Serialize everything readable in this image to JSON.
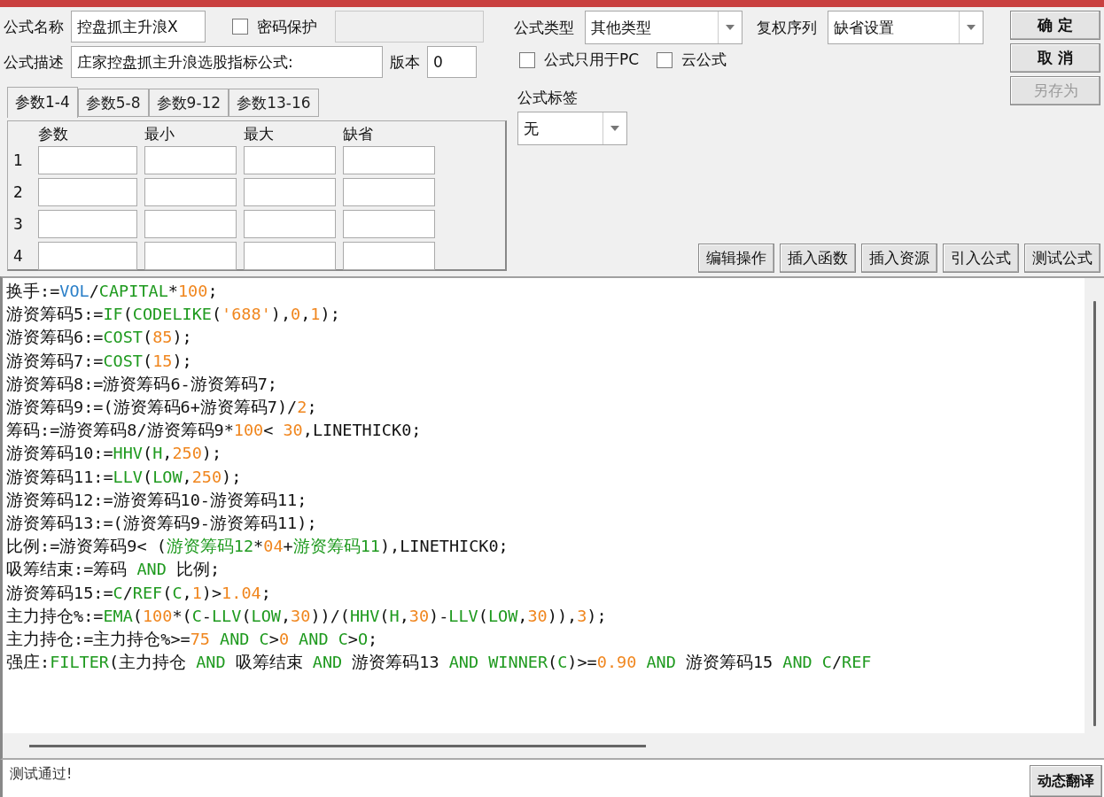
{
  "form": {
    "name_label": "公式名称",
    "name_value": "控盘抓主升浪X",
    "password": {
      "label": "密码保护",
      "checked": false
    },
    "description_label": "公式描述",
    "description_value": "庄家控盘抓主升浪选股指标公式:",
    "version_label": "版本",
    "version_value": "0"
  },
  "param_tabs": [
    {
      "label": "参数1-4",
      "selected": true
    },
    {
      "label": "参数5-8",
      "selected": false
    },
    {
      "label": "参数9-12",
      "selected": false
    },
    {
      "label": "参数13-16",
      "selected": false
    }
  ],
  "param_columns": [
    "参数",
    "最小",
    "最大",
    "缺省"
  ],
  "param_rows": [
    "1",
    "2",
    "3",
    "4"
  ],
  "formula_type": {
    "label": "公式类型",
    "value": "其他类型"
  },
  "rights_order": {
    "label": "复权序列",
    "value": "缺省设置"
  },
  "options": [
    {
      "label": "公式只用于PC",
      "checked": false
    },
    {
      "label": "云公式",
      "checked": false
    }
  ],
  "tag": {
    "label": "公式标签",
    "value": "无"
  },
  "dialog_buttons": [
    {
      "label": "确 定",
      "disabled": false
    },
    {
      "label": "取 消",
      "disabled": false
    },
    {
      "label": "另存为",
      "disabled": true
    }
  ],
  "tool_buttons": [
    "编辑操作",
    "插入函数",
    "插入资源",
    "引入公式",
    "测试公式"
  ],
  "code_lines": [
    [
      {
        "kind": "plain",
        "text": "换手:="
      },
      {
        "kind": "var",
        "text": "VOL"
      },
      {
        "kind": "plain",
        "text": "/"
      },
      {
        "kind": "func",
        "text": "CAPITAL"
      },
      {
        "kind": "plain",
        "text": "*"
      },
      {
        "kind": "num",
        "text": "100"
      },
      {
        "kind": "plain",
        "text": ";"
      }
    ],
    [
      {
        "kind": "plain",
        "text": "游资筹码5:="
      },
      {
        "kind": "func",
        "text": "IF"
      },
      {
        "kind": "plain",
        "text": "("
      },
      {
        "kind": "func",
        "text": "CODELIKE"
      },
      {
        "kind": "plain",
        "text": "("
      },
      {
        "kind": "num",
        "text": "'688'"
      },
      {
        "kind": "plain",
        "text": "),"
      },
      {
        "kind": "num",
        "text": "0"
      },
      {
        "kind": "plain",
        "text": ","
      },
      {
        "kind": "num",
        "text": "1"
      },
      {
        "kind": "plain",
        "text": ");"
      }
    ],
    [
      {
        "kind": "plain",
        "text": "游资筹码6:="
      },
      {
        "kind": "func",
        "text": "COST"
      },
      {
        "kind": "plain",
        "text": "("
      },
      {
        "kind": "num",
        "text": "85"
      },
      {
        "kind": "plain",
        "text": ");"
      }
    ],
    [
      {
        "kind": "plain",
        "text": "游资筹码7:="
      },
      {
        "kind": "func",
        "text": "COST"
      },
      {
        "kind": "plain",
        "text": "("
      },
      {
        "kind": "num",
        "text": "15"
      },
      {
        "kind": "plain",
        "text": ");"
      }
    ],
    [
      {
        "kind": "plain",
        "text": "游资筹码8:=游资筹码6-游资筹码7;"
      }
    ],
    [
      {
        "kind": "plain",
        "text": "游资筹码9:=(游资筹码6+游资筹码7)/"
      },
      {
        "kind": "num",
        "text": "2"
      },
      {
        "kind": "plain",
        "text": ";"
      }
    ],
    [
      {
        "kind": "plain",
        "text": "筹码:=游资筹码8/游资筹码9*"
      },
      {
        "kind": "num",
        "text": "100"
      },
      {
        "kind": "plain",
        "text": "<"
      },
      {
        "kind": "num",
        "text": "30",
        "space": true
      },
      {
        "kind": "plain",
        "text": ",LINETHICK0;"
      }
    ],
    [
      {
        "kind": "plain",
        "text": "游资筹码10:="
      },
      {
        "kind": "func",
        "text": "HHV"
      },
      {
        "kind": "plain",
        "text": "("
      },
      {
        "kind": "func",
        "text": "H"
      },
      {
        "kind": "plain",
        "text": ","
      },
      {
        "kind": "num",
        "text": "250"
      },
      {
        "kind": "plain",
        "text": ");"
      }
    ],
    [
      {
        "kind": "plain",
        "text": "游资筹码11:="
      },
      {
        "kind": "func",
        "text": "LLV"
      },
      {
        "kind": "plain",
        "text": "("
      },
      {
        "kind": "func",
        "text": "LOW"
      },
      {
        "kind": "plain",
        "text": ","
      },
      {
        "kind": "num",
        "text": "250"
      },
      {
        "kind": "plain",
        "text": ");"
      }
    ],
    [
      {
        "kind": "plain",
        "text": "游资筹码12:=游资筹码10-游资筹码11;"
      }
    ],
    [
      {
        "kind": "plain",
        "text": "游资筹码13:=(游资筹码9-游资筹码11);"
      }
    ],
    [
      {
        "kind": "plain",
        "text": "比例:=游资筹码9< ("
      },
      {
        "kind": "func",
        "text": "游资筹码12"
      },
      {
        "kind": "plain",
        "text": "*"
      },
      {
        "kind": "num",
        "text": "04"
      },
      {
        "kind": "plain",
        "text": "+"
      },
      {
        "kind": "func",
        "text": "游资筹码11"
      },
      {
        "kind": "plain",
        "text": "),LINETHICK0;"
      }
    ],
    [
      {
        "kind": "plain",
        "text": "吸筹结束:=筹码"
      },
      {
        "kind": "func",
        "text": "AND",
        "space": true
      },
      {
        "kind": "plain",
        "text": "比例;",
        "space": true
      }
    ],
    [
      {
        "kind": "plain",
        "text": "游资筹码15:="
      },
      {
        "kind": "func",
        "text": "C"
      },
      {
        "kind": "plain",
        "text": "/"
      },
      {
        "kind": "func",
        "text": "REF"
      },
      {
        "kind": "plain",
        "text": "("
      },
      {
        "kind": "func",
        "text": "C"
      },
      {
        "kind": "plain",
        "text": ","
      },
      {
        "kind": "num",
        "text": "1"
      },
      {
        "kind": "plain",
        "text": ")>"
      },
      {
        "kind": "num",
        "text": "1.04"
      },
      {
        "kind": "plain",
        "text": ";"
      }
    ],
    [
      {
        "kind": "plain",
        "text": "主力持仓%:="
      },
      {
        "kind": "func",
        "text": "EMA"
      },
      {
        "kind": "plain",
        "text": "("
      },
      {
        "kind": "num",
        "text": "100"
      },
      {
        "kind": "plain",
        "text": "*("
      },
      {
        "kind": "func",
        "text": "C"
      },
      {
        "kind": "plain",
        "text": "-"
      },
      {
        "kind": "func",
        "text": "LLV"
      },
      {
        "kind": "plain",
        "text": "("
      },
      {
        "kind": "func",
        "text": "LOW"
      },
      {
        "kind": "plain",
        "text": ","
      },
      {
        "kind": "num",
        "text": "30"
      },
      {
        "kind": "plain",
        "text": "))/("
      },
      {
        "kind": "func",
        "text": "HHV"
      },
      {
        "kind": "plain",
        "text": "("
      },
      {
        "kind": "func",
        "text": "H"
      },
      {
        "kind": "plain",
        "text": ","
      },
      {
        "kind": "num",
        "text": "30"
      },
      {
        "kind": "plain",
        "text": ")-"
      },
      {
        "kind": "func",
        "text": "LLV"
      },
      {
        "kind": "plain",
        "text": "("
      },
      {
        "kind": "func",
        "text": "LOW"
      },
      {
        "kind": "plain",
        "text": ","
      },
      {
        "kind": "num",
        "text": "30"
      },
      {
        "kind": "plain",
        "text": ")),"
      },
      {
        "kind": "num",
        "text": "3"
      },
      {
        "kind": "plain",
        "text": ");"
      }
    ],
    [
      {
        "kind": "plain",
        "text": "主力持仓:=主力持仓%>="
      },
      {
        "kind": "num",
        "text": "75"
      },
      {
        "kind": "func",
        "text": "AND",
        "space": true
      },
      {
        "kind": "func",
        "text": "C",
        "space": true
      },
      {
        "kind": "plain",
        "text": ">"
      },
      {
        "kind": "num",
        "text": "0"
      },
      {
        "kind": "func",
        "text": "AND",
        "space": true
      },
      {
        "kind": "func",
        "text": "C",
        "space": true
      },
      {
        "kind": "plain",
        "text": ">"
      },
      {
        "kind": "func",
        "text": "O"
      },
      {
        "kind": "plain",
        "text": ";"
      }
    ],
    [
      {
        "kind": "plain",
        "text": "强庄:"
      },
      {
        "kind": "func",
        "text": "FILTER"
      },
      {
        "kind": "plain",
        "text": "(主力持仓"
      },
      {
        "kind": "func",
        "text": "AND",
        "space": true
      },
      {
        "kind": "plain",
        "text": "吸筹结束",
        "space": true
      },
      {
        "kind": "func",
        "text": "AND",
        "space": true
      },
      {
        "kind": "plain",
        "text": "游资筹码13",
        "space": true
      },
      {
        "kind": "func",
        "text": "AND",
        "space": true
      },
      {
        "kind": "func",
        "text": "WINNER",
        "space": true
      },
      {
        "kind": "plain",
        "text": "("
      },
      {
        "kind": "func",
        "text": "C"
      },
      {
        "kind": "plain",
        "text": ")>="
      },
      {
        "kind": "num",
        "text": "0.90"
      },
      {
        "kind": "func",
        "text": "AND",
        "space": true
      },
      {
        "kind": "plain",
        "text": "游资筹码15",
        "space": true
      },
      {
        "kind": "func",
        "text": "AND",
        "space": true
      },
      {
        "kind": "func",
        "text": "C",
        "space": true
      },
      {
        "kind": "plain",
        "text": "/"
      },
      {
        "kind": "func",
        "text": "REF"
      }
    ]
  ],
  "status": "测试通过!",
  "translate_button": "动态翻译"
}
